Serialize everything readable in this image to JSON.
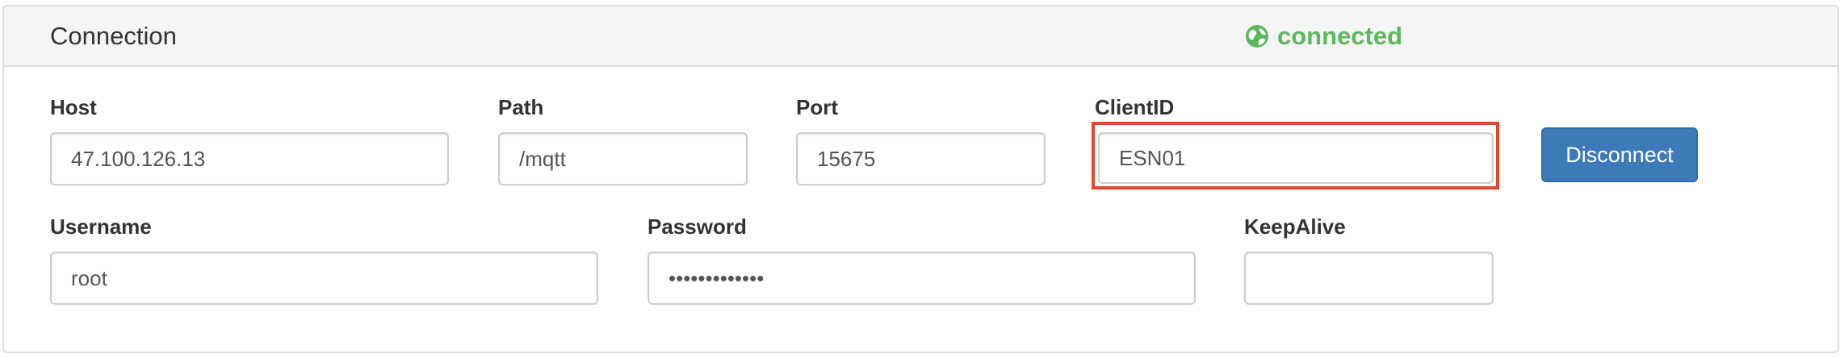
{
  "panel": {
    "title": "Connection",
    "status": {
      "text": "connected",
      "icon": "globe-icon",
      "color": "#5cb85c"
    }
  },
  "fields": {
    "host": {
      "label": "Host",
      "value": "47.100.126.13"
    },
    "path": {
      "label": "Path",
      "value": "/mqtt"
    },
    "port": {
      "label": "Port",
      "value": "15675"
    },
    "client_id": {
      "label": "ClientID",
      "value": "ESN01",
      "highlight_color": "#e0472f"
    },
    "username": {
      "label": "Username",
      "value": "root"
    },
    "password": {
      "label": "Password",
      "value": "•••••••••••••"
    },
    "keepalive": {
      "label": "KeepAlive",
      "value": ""
    }
  },
  "actions": {
    "disconnect_label": "Disconnect",
    "button_color": "#3f7ab8"
  }
}
